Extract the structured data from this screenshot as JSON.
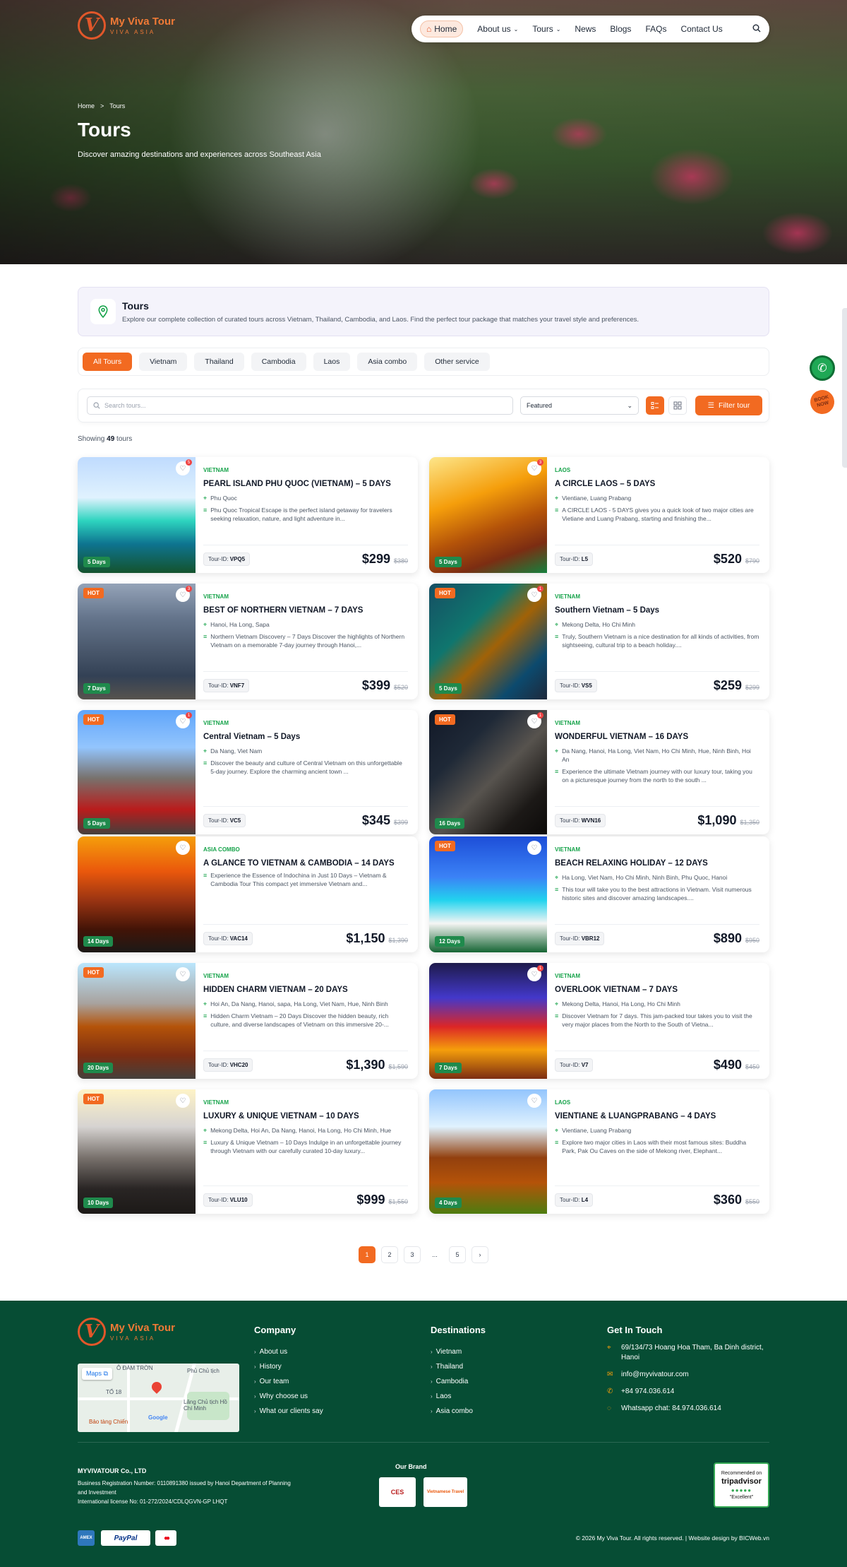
{
  "brand": {
    "name": "My Viva Tour",
    "tagline": "VIVA ASIA",
    "mark": "V"
  },
  "nav": {
    "items": [
      {
        "label": "Home",
        "active": true
      },
      {
        "label": "About us",
        "dropdown": true
      },
      {
        "label": "Tours",
        "dropdown": true
      },
      {
        "label": "News"
      },
      {
        "label": "Blogs"
      },
      {
        "label": "FAQs"
      },
      {
        "label": "Contact Us"
      }
    ]
  },
  "breadcrumb": {
    "home": "Home",
    "sep": ">",
    "current": "Tours"
  },
  "hero": {
    "title": "Tours",
    "subtitle": "Discover amazing destinations and experiences across Southeast Asia"
  },
  "intro": {
    "title": "Tours",
    "text": "Explore our complete collection of curated tours across Vietnam, Thailand, Cambodia, and Laos. Find the perfect tour package that matches your travel style and preferences."
  },
  "tabs": [
    "All Tours",
    "Vietnam",
    "Thailand",
    "Cambodia",
    "Laos",
    "Asia combo",
    "Other service"
  ],
  "filter": {
    "search_placeholder": "Search tours...",
    "sort_value": "Featured",
    "filter_button": "Filter tour"
  },
  "showing": {
    "prefix": "Showing",
    "count": "49",
    "suffix": "tours"
  },
  "tours": [
    {
      "country": "VIETNAM",
      "title": "PEARL ISLAND PHU QUOC (VIETNAM) – 5 DAYS",
      "location": "Phu Quoc",
      "desc": "Phu Quoc Tropical Escape is the perfect island getaway for travelers seeking relaxation, nature, and light adventure in...",
      "id": "VPQ5",
      "price": "$299",
      "old": "$380",
      "days": "5 Days",
      "hot": false,
      "likes": "5"
    },
    {
      "country": "LAOS",
      "title": "A CIRCLE LAOS – 5 DAYS",
      "location": "Vientiane, Luang Prabang",
      "desc": "A CIRCLE LAOS - 5 DAYS  gives you a quick look of two major cities are Vietiane and Luang Prabang, starting and finishing the...",
      "id": "L5",
      "price": "$520",
      "old": "$790",
      "days": "5 Days",
      "hot": false,
      "likes": "3"
    },
    {
      "country": "VIETNAM",
      "title": "BEST OF NORTHERN VIETNAM – 7 DAYS",
      "location": "Hanoi, Ha Long, Sapa",
      "desc": "Northern Vietnam Discovery – 7 Days Discover the highlights of Northern Vietnam on a memorable 7-day journey through Hanoi,...",
      "id": "VNF7",
      "price": "$399",
      "old": "$520",
      "days": "7 Days",
      "hot": true,
      "likes": "3"
    },
    {
      "country": "VIETNAM",
      "title": "Southern Vietnam – 5 Days",
      "location": "Mekong Delta, Ho Chi Minh",
      "desc": "Truly, Southern Vietnam is a nice destination for all kinds of activities, from sightseeing, cultural trip to a beach holiday....",
      "id": "VS5",
      "price": "$259",
      "old": "$299",
      "days": "5 Days",
      "hot": true,
      "likes": "1"
    },
    {
      "country": "VIETNAM",
      "title": "Central Vietnam – 5 Days",
      "location": "Da Nang, Viet Nam",
      "desc": "Discover the beauty and culture of Central Vietnam on this unforgettable 5-day journey. Explore the charming ancient town ...",
      "id": "VC5",
      "price": "$345",
      "old": "$399",
      "days": "5 Days",
      "hot": true,
      "likes": "1"
    },
    {
      "country": "VIETNAM",
      "title": "WONDERFUL VIETNAM – 16 DAYS",
      "location": "Da Nang, Hanoi, Ha Long, Viet Nam, Ho Chi Minh, Hue, Ninh Binh, Hoi An",
      "desc": "Experience the ultimate Vietnam journey with our luxury tour, taking you on a picturesque journey from the north to the south ...",
      "id": "WVN16",
      "price": "$1,090",
      "old": "$1,350",
      "days": "16 Days",
      "hot": true,
      "likes": "1"
    },
    {
      "country": "ASIA COMBO",
      "title": "A GLANCE TO VIETNAM & CAMBODIA – 14 DAYS",
      "location": "",
      "desc": "Experience the Essence of Indochina in Just 10 Days – Vietnam & Cambodia Tour This compact yet immersive Vietnam and...",
      "id": "VAC14",
      "price": "$1,150",
      "old": "$1,390",
      "days": "14 Days",
      "hot": false,
      "likes": ""
    },
    {
      "country": "VIETNAM",
      "title": "BEACH RELAXING HOLIDAY – 12 DAYS",
      "location": "Ha Long, Viet Nam, Ho Chi Minh, Ninh Binh, Phu Quoc, Hanoi",
      "desc": "This tour will take you to the best attractions in Vietnam. Visit numerous historic sites and discover amazing landscapes....",
      "id": "VBR12",
      "price": "$890",
      "old": "$950",
      "days": "12 Days",
      "hot": true,
      "likes": ""
    },
    {
      "country": "VIETNAM",
      "title": "HIDDEN CHARM VIETNAM – 20 DAYS",
      "location": "Hoi An, Da Nang, Hanoi, sapa, Ha Long, Viet Nam, Hue, Ninh Binh",
      "desc": "Hidden Charm Vietnam – 20 Days Discover the hidden beauty, rich culture, and diverse landscapes of Vietnam on this immersive 20-...",
      "id": "VHC20",
      "price": "$1,390",
      "old": "$1,590",
      "days": "20 Days",
      "hot": true,
      "likes": ""
    },
    {
      "country": "VIETNAM",
      "title": "OVERLOOK VIETNAM – 7 DAYS",
      "location": "Mekong Delta, Hanoi, Ha Long, Ho Chi Minh",
      "desc": "Discover Vietnam for 7 days. This jam-packed tour takes you to visit the very major places from the North to the South of Vietna...",
      "id": "V7",
      "price": "$490",
      "old": "$450",
      "days": "7 Days",
      "hot": false,
      "likes": "1"
    },
    {
      "country": "VIETNAM",
      "title": "LUXURY & UNIQUE VIETNAM – 10 DAYS",
      "location": "Mekong Delta, Hoi An, Da Nang, Hanoi, Ha Long, Ho Chi Minh, Hue",
      "desc": "Luxury & Unique Vietnam – 10 Days Indulge in an unforgettable journey through Vietnam with our carefully curated 10-day luxury...",
      "id": "VLU10",
      "price": "$999",
      "old": "$1,550",
      "days": "10 Days",
      "hot": true,
      "likes": ""
    },
    {
      "country": "LAOS",
      "title": "VIENTIANE & LUANGPRABANG – 4 DAYS",
      "location": "Vientiane, Luang Prabang",
      "desc": "Explore two major cities in Laos with their most famous sites: Buddha Park, Pak Ou Caves on the side of Mekong river, Elephant...",
      "id": "L4",
      "price": "$360",
      "old": "$550",
      "days": "4 Days",
      "hot": false,
      "likes": ""
    }
  ],
  "tour_id_label": "Tour-ID:",
  "pagination": [
    "1",
    "2",
    "3",
    "...",
    "5"
  ],
  "floating": {
    "book": "BOOK NOW"
  },
  "footer": {
    "company_title": "Company",
    "company_links": [
      "About us",
      "History",
      "Our team",
      "Why choose us",
      "What our clients say"
    ],
    "dest_title": "Destinations",
    "dest_links": [
      "Vietnam",
      "Thailand",
      "Cambodia",
      "Laos",
      "Asia combo"
    ],
    "contact_title": "Get In Touch",
    "address": "69/134/73 Hoang Hoa Tham, Ba Dinh district, Hanoi",
    "email": "info@myvivatour.com",
    "phone": "+84 974.036.614",
    "whatsapp": "Whatsapp chat: 84.974.036.614",
    "map": {
      "button": "Maps",
      "l1": "Ô ĐÀM TRỜN",
      "l2": "TỔ 18",
      "l3": "Phủ Chủ tịch",
      "l4": "Lăng Chủ tịch Hồ Chí Minh",
      "l5": "Bảo tàng Chiến",
      "l6": "Google"
    },
    "company_name": "MYVIVATOUR Co., LTD",
    "reg": "Business Registration Number: 0110891380 issued by Hanoi Department of Planning and Investment",
    "license": "International license No: 01-272/2024/CDLQGVN-GP LHQT",
    "our_brand": "Our Brand",
    "brand1": "CES",
    "brand2": "Vietnamese Travel",
    "trip_top": "Recommended on",
    "trip_name": "tripadvisor",
    "trip_dots": "●●●●●",
    "trip_bottom": "\"Excellent\"",
    "pay": [
      "AMEX",
      "PayPal",
      "●●"
    ],
    "copyright": "© 2026 My Viva Tour. All rights reserved. | Website design by BICWeb.vn"
  }
}
